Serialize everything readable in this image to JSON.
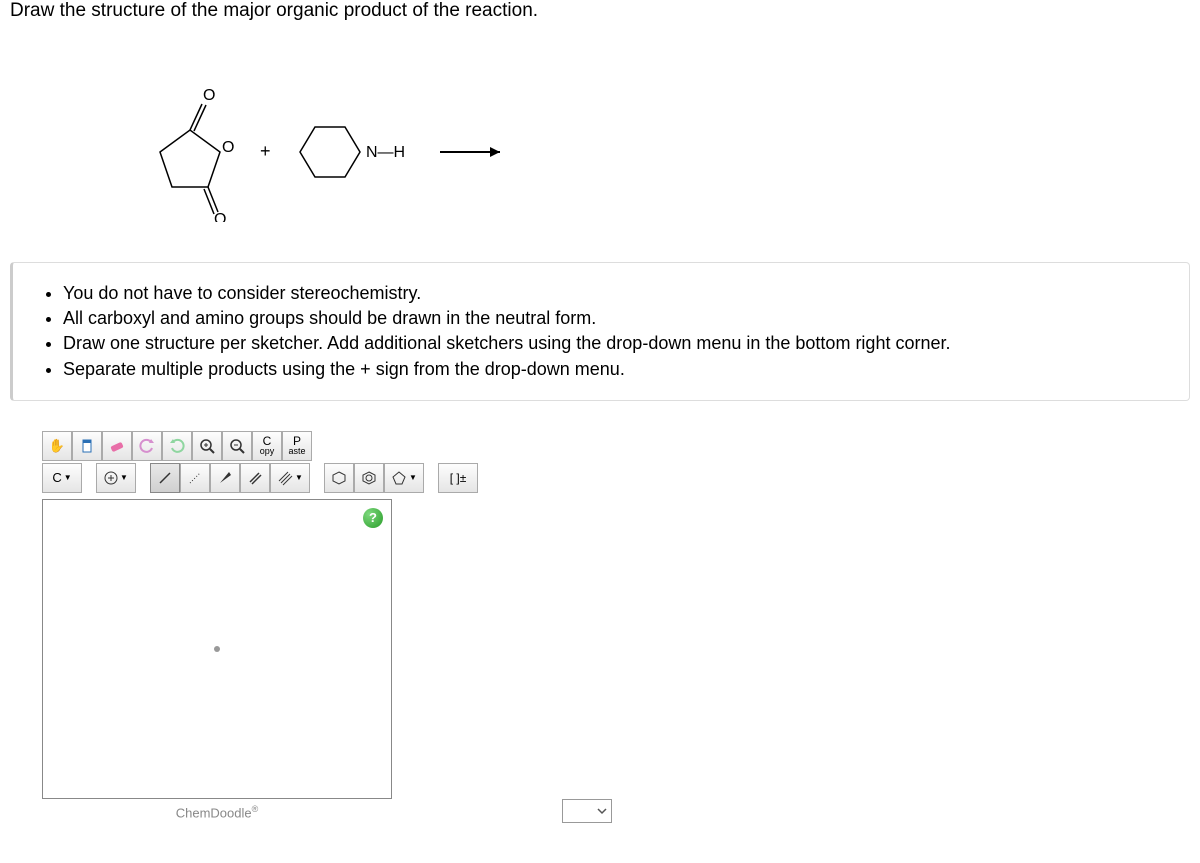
{
  "question": {
    "title": "Draw the structure of the major organic product of the reaction."
  },
  "reaction": {
    "plus": "+",
    "nh_label": "N—H",
    "arrow": "→",
    "atom_O_top": "O",
    "atom_O_mid": "O",
    "atom_O_bot": "O"
  },
  "instructions": [
    "You do not have to consider stereochemistry.",
    "All carboxyl and amino groups should be drawn in the neutral form.",
    "Draw one structure per sketcher. Add additional sketchers using the drop-down menu in the bottom right corner.",
    "Separate multiple products using the + sign from the drop-down menu."
  ],
  "toolbar": {
    "copy_top": "C",
    "copy_bot": "opy",
    "paste_top": "P",
    "paste_bot": "aste",
    "carbon": "C",
    "charge": "[ ]±"
  },
  "footer": {
    "chemdoodle": "ChemDoodle"
  }
}
